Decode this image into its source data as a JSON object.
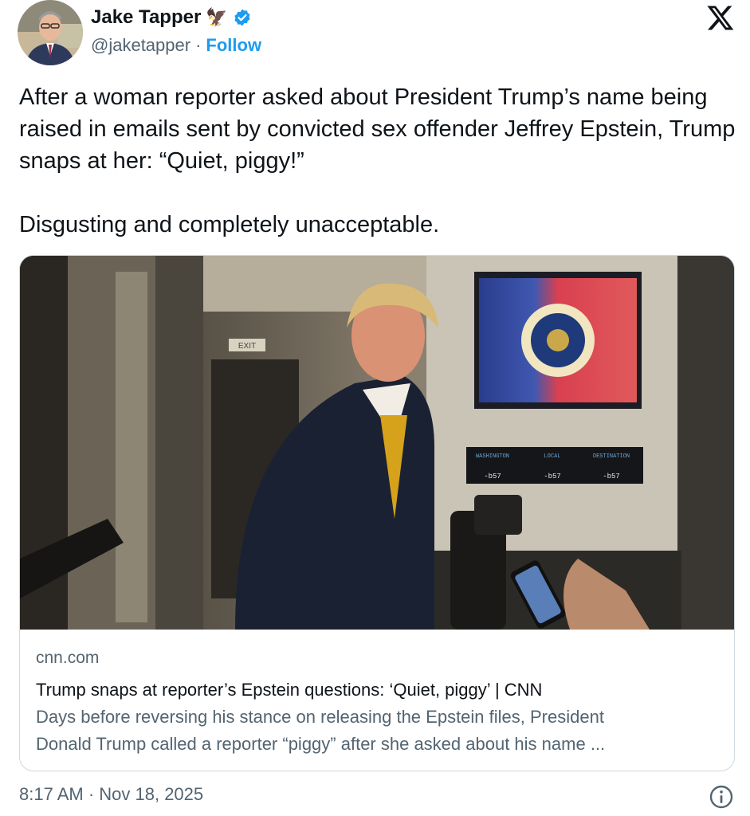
{
  "author": {
    "name": "Jake Tapper",
    "name_emoji": "🦅",
    "handle": "@jaketapper",
    "separator": "·",
    "follow_label": "Follow",
    "verified_color": "#1d9bf0"
  },
  "tweet": {
    "paragraph_1": "After a woman reporter asked about President Trump’s name being raised in emails sent by convicted sex offender Jeffrey Epstein, Trump snaps at her: “Quiet, piggy!”",
    "paragraph_2": "Disgusting and completely unacceptable."
  },
  "card": {
    "domain": "cnn.com",
    "title": "Trump snaps at reporter’s Epstein questions: ‘Quiet, piggy’ | CNN",
    "description_line_1": "Days before reversing his stance on releasing the Epstein files, President",
    "description_line_2": "Donald Trump called a reporter “piggy” after she asked about his name ...",
    "clock_labels": [
      "WASHINGTON",
      "LOCAL",
      "DESTINATION"
    ],
    "clock_times": [
      "-b57",
      "-b57",
      "-b57"
    ],
    "exit_sign": "EXIT"
  },
  "footer": {
    "timestamp": "8:17 AM · Nov 18, 2025"
  },
  "icons": {
    "platform_logo": "x-logo-icon",
    "verified": "verified-badge-icon",
    "info": "info-icon"
  },
  "colors": {
    "link": "#1d9bf0",
    "secondary_text": "#536471",
    "primary_text": "#0f1419",
    "border": "#cfd9de"
  }
}
